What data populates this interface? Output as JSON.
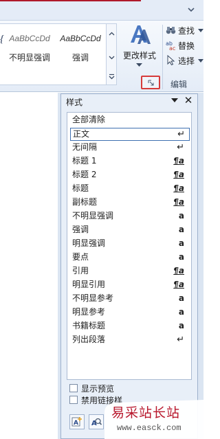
{
  "colors": {
    "accent": "#3e6fb0",
    "highlight_box": "#d63a3a",
    "watermark": "#b8172c"
  },
  "ribbon": {
    "gallery": {
      "items": [
        {
          "sample": "AaBbCcDd",
          "label": "不明显强调"
        },
        {
          "sample": "AaBbCcDd",
          "label": "强调"
        }
      ]
    },
    "change_styles_label": "更改样式",
    "editing": {
      "find_label": "查找",
      "replace_label": "替换",
      "select_label": "选择",
      "group_label": "编辑"
    }
  },
  "styles_pane": {
    "title": "样式",
    "items": [
      {
        "name": "全部清除",
        "glyph": ""
      },
      {
        "name": "正文",
        "glyph": "↵"
      },
      {
        "name": "无间隔",
        "glyph": "↵"
      },
      {
        "name": "标题 1",
        "glyph": "¶a"
      },
      {
        "name": "标题 2",
        "glyph": "¶a"
      },
      {
        "name": "标题",
        "glyph": "¶a"
      },
      {
        "name": "副标题",
        "glyph": "¶a"
      },
      {
        "name": "不明显强调",
        "glyph": "a"
      },
      {
        "name": "强调",
        "glyph": "a"
      },
      {
        "name": "明显强调",
        "glyph": "a"
      },
      {
        "name": "要点",
        "glyph": "a"
      },
      {
        "name": "引用",
        "glyph": "¶a"
      },
      {
        "name": "明显引用",
        "glyph": "¶a"
      },
      {
        "name": "不明显参考",
        "glyph": "a"
      },
      {
        "name": "明显参考",
        "glyph": "a"
      },
      {
        "name": "书籍标题",
        "glyph": "a"
      },
      {
        "name": "列出段落",
        "glyph": "↵"
      }
    ],
    "selected_index": 1,
    "show_preview_label": "显示预览",
    "disable_linked_label": "禁用链接样"
  },
  "watermark": {
    "text": "易采站长站",
    "url": "www.easck.com"
  }
}
